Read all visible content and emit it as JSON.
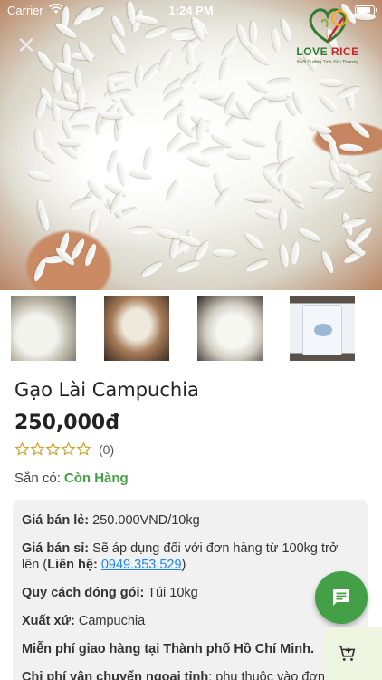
{
  "status_bar": {
    "carrier": "Carrier",
    "time": "1:24 PM"
  },
  "logo": {
    "brand_love": "LOVE ",
    "brand_rice": "RICE",
    "slogan": "Nuôi Dưỡng Tình Yêu Thương"
  },
  "product": {
    "name": "Gạo Lài Campuchia",
    "price": "250,000đ",
    "rating": 0,
    "rating_count": "(0)",
    "stock_label": "Sẵn có:",
    "stock_value": "Còn Hàng"
  },
  "thumbnails": [
    {
      "alt": "rice-grains-on-spoon"
    },
    {
      "alt": "rice-in-pot-with-logo"
    },
    {
      "alt": "rice-scoop-dark-background"
    },
    {
      "alt": "rice-bag-package"
    }
  ],
  "details": {
    "retail_label": "Giá bán lẻ:",
    "retail_value": "250.000VND/10kg",
    "wholesale_label": "Giá bán sỉ:",
    "wholesale_value": "Sẽ áp dụng đối với đơn hàng từ 100kg trở lên (",
    "contact_label": "Liên hệ:",
    "phone": "0949.353.529",
    "wholesale_close": ")",
    "packing_label": "Quy cách đóng gói:",
    "packing_value": "Túi 10kg",
    "origin_label": "Xuất xứ:",
    "origin_value": "Campuchia",
    "free_ship": "Miễn phí giao hàng tại Thành phố Hồ Chí Minh.",
    "shipping_label": "Chi phí vận chuyển ngoại tỉnh",
    "shipping_value": ": phụ thuộc vào đơn"
  },
  "colors": {
    "accent_green": "#43a047",
    "link_blue": "#1e88e5",
    "details_bg": "#f1f1f1",
    "star_color": "#c9a227"
  }
}
